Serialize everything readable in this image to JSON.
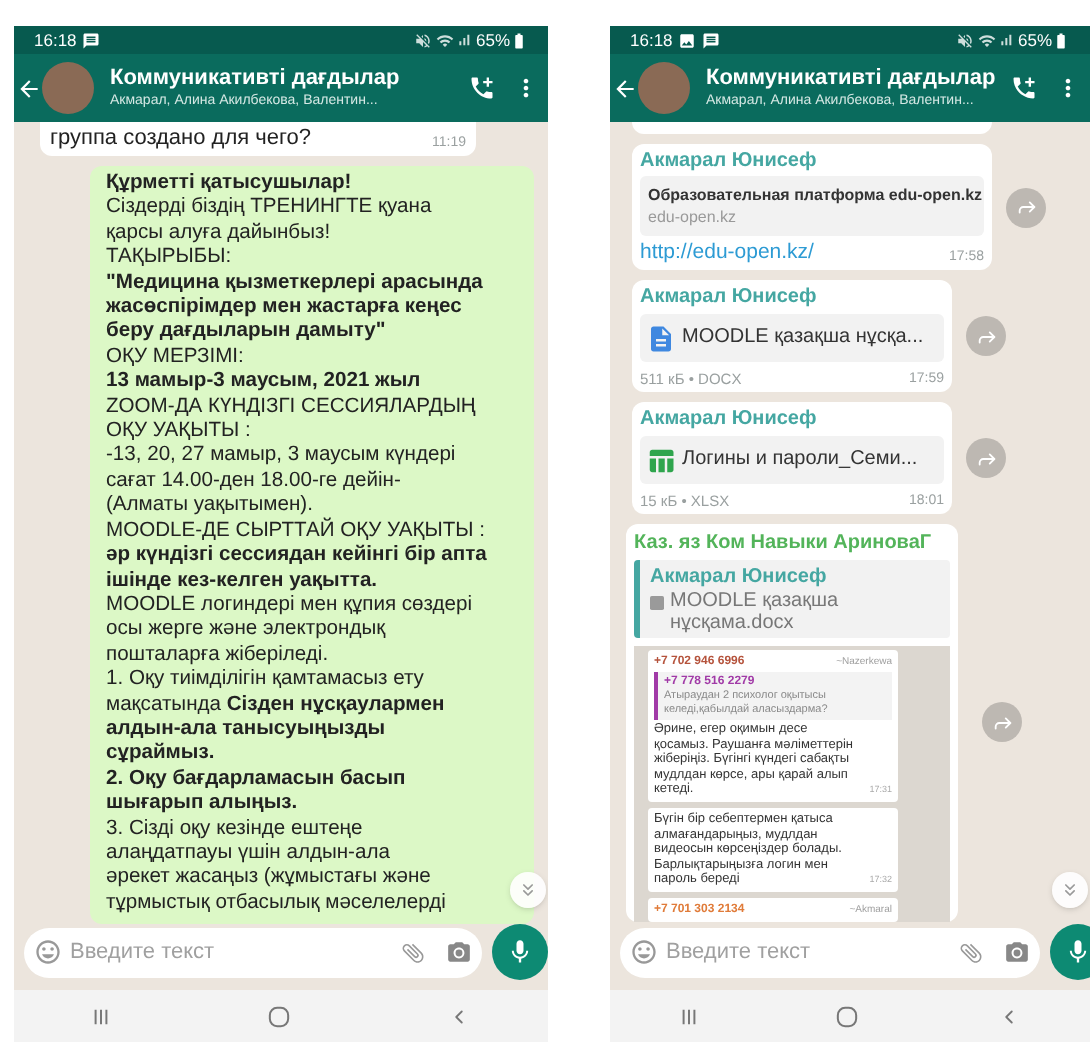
{
  "phones": [
    {
      "status_bar": {
        "time": "16:18",
        "notification_icons": [
          {
            "kind": "message"
          }
        ],
        "battery": "65%"
      },
      "header": {
        "title": "Коммуникативті дағдылар",
        "subtitle": "Акмарал, Алина Акилбекова, Валентин..."
      },
      "messages": [
        {
          "kind": "text",
          "outgoing": false,
          "text": "группа создано для чего?",
          "time": "11:19"
        },
        {
          "kind": "text",
          "outgoing": true,
          "text": "**Құрметті қатысушылар!**\nСіздерді біздің ТРЕНИНГТЕ қуана\nқарсы алуға дайынбыз!\nТАҚЫРЫБЫ:\n**\"Медицина қызметкерлері арасында**\n**жасөспірімдер мен жастарға кеңес**\n**беру дағдыларын дамыту\"**\nОҚУ МЕРЗІМІ:\n**13 мамыр-3 маусым, 2021 жыл**\nZOOM-ДА КҮНДІЗГІ СЕССИЯЛАРДЫҢ\nОҚУ УАҚЫТЫ :\n-13, 20, 27 мамыр, 3 маусым күндері\nсағат 14.00-ден 18.00-ге дейін-\n(Алматы уақытымен).\nMOODLE-ДЕ СЫРТТАЙ ОҚУ УАҚЫТЫ :\n**әр күндізгі сессиядан кейінгі бір апта**\n**ішінде кез-келген уақытта.**\nMOODLE логиндері мен құпия сөздері\nосы жерге және электрондық\nпошталарға жіберіледі.\n1. Оқу тиімділігін қамтамасыз ету\nмақсатында **Сізден нұсқаулармен**\n**алдын-ала танысуыңызды**\n**сұраймыз.**\n**2. Оқу бағдарламасын басып**\n**шығарып алыңыз.**\n3. Сізді оқу кезінде ештеңе\nалаңдатпауы үшін алдын-ала\nәрекет жасаңыз (жұмыстағы және\nтұрмыстық отбасылық мәселелерді"
        }
      ],
      "input": {
        "placeholder": "Введите текст"
      }
    },
    {
      "status_bar": {
        "time": "16:18",
        "notification_icons": [
          {
            "kind": "gallery"
          },
          {
            "kind": "message"
          }
        ],
        "battery": "65%"
      },
      "header": {
        "title": "Коммуникативті дағдылар",
        "subtitle": "Акмарал, Алина Акилбекова, Валентин..."
      },
      "messages": [
        {
          "kind": "clipped"
        },
        {
          "kind": "link",
          "sender": "Акмарал Юнисеф",
          "preview_title": "Образовательная платформа edu-open.kz",
          "preview_domain": "edu-open.kz",
          "url": "http://edu-open.kz/",
          "time": "17:58"
        },
        {
          "kind": "document",
          "attachment": {
            "kind": "document"
          },
          "sender": "Акмарал Юнисеф",
          "name": "MOODLE қазақша нұсқа...",
          "meta": "511 кБ • DOCX",
          "time": "17:59"
        },
        {
          "kind": "document",
          "attachment": {
            "kind": "spreadsheet"
          },
          "sender": "Акмарал Юнисеф",
          "name": "Логины и пароли_Семи...",
          "meta": "15 кБ • XLSX",
          "time": "18:01"
        },
        {
          "kind": "reply",
          "sender": "Каз. яз Ком Навыки АриноваГ",
          "quote": {
            "sender": "Акмарал Юнисеф",
            "text": "MOODLE қазақша нұсқама.docx"
          },
          "screenshot": [
            {
              "sender": "+7 702 946 6996",
              "color": "#b5533c",
              "alias": "~Nazerkewa",
              "quote": {
                "sender": "+7 778 516 2279",
                "color": "#a13aa7",
                "text": "Атыраудан 2 психолог оқытысы келеді,қабылдай аласыздарма?"
              },
              "text": "Әрине, егер оқимын десе қосамыз. Раушанға мәліметтерін жіберіңіз. Бүгінгі күндегі сабақты мудлдан көрсе, ары қарай алып кетеді.",
              "time": "17:31"
            },
            {
              "text": "Бүгін бір себептермен қатыса алмағандарыңыз, мудлдан видеосын көрсеңіздер болады. Барлықтарыңызға логин мен пароль береді",
              "time": "17:32"
            },
            {
              "sender": "+7 701 303 2134",
              "color": "#e07b39",
              "alias": "~Akmaral"
            }
          ]
        }
      ],
      "input": {
        "placeholder": "Введите текст"
      }
    }
  ]
}
